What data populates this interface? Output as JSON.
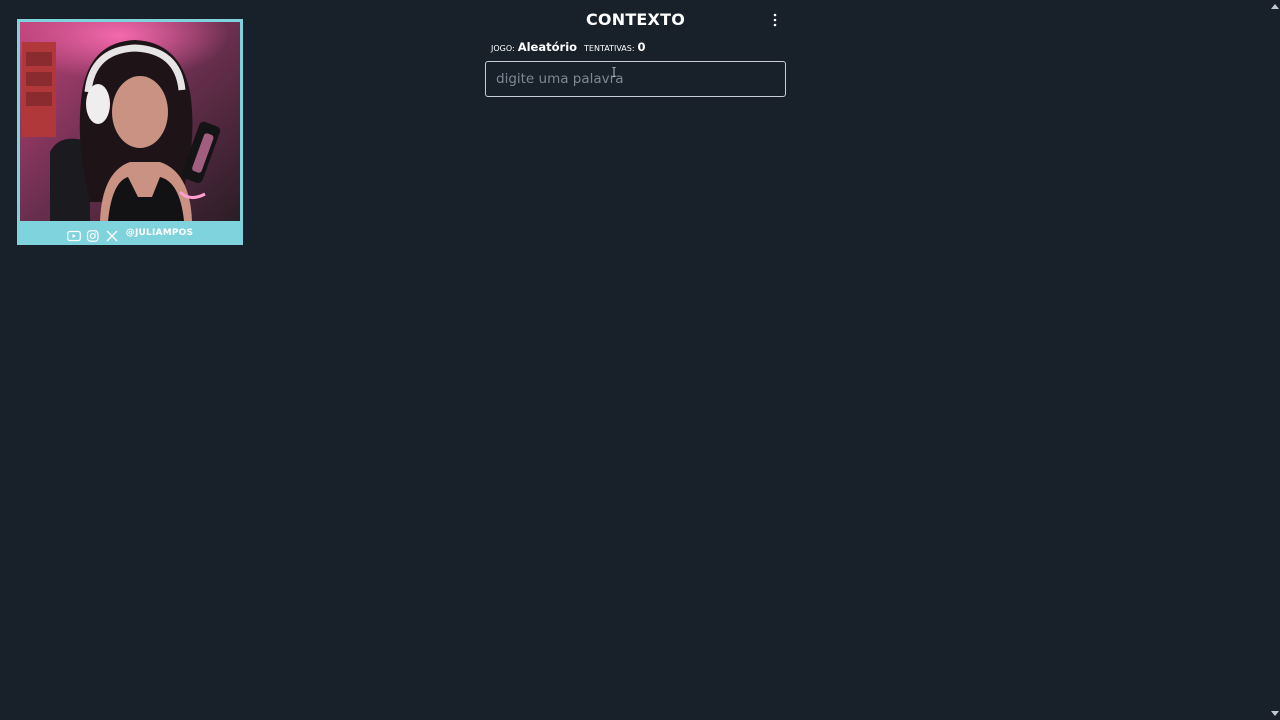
{
  "header": {
    "title": "CONTEXTO",
    "menu_icon": "vertical-dots-icon"
  },
  "info": {
    "game_label": "jogo:",
    "game_value": "Aleatório",
    "attempts_label": "tentativas:",
    "attempts_value": "0"
  },
  "input": {
    "placeholder": "digite uma palavra",
    "value": ""
  },
  "webcam": {
    "icons": [
      "youtube-icon",
      "instagram-icon",
      "x-icon"
    ],
    "handle": "@JULIAMPOS",
    "border_color": "#7fd3dd"
  },
  "colors": {
    "background": "#18202a",
    "text": "#ffffff",
    "placeholder": "#7e8793",
    "input_border": "#c9ced6"
  }
}
